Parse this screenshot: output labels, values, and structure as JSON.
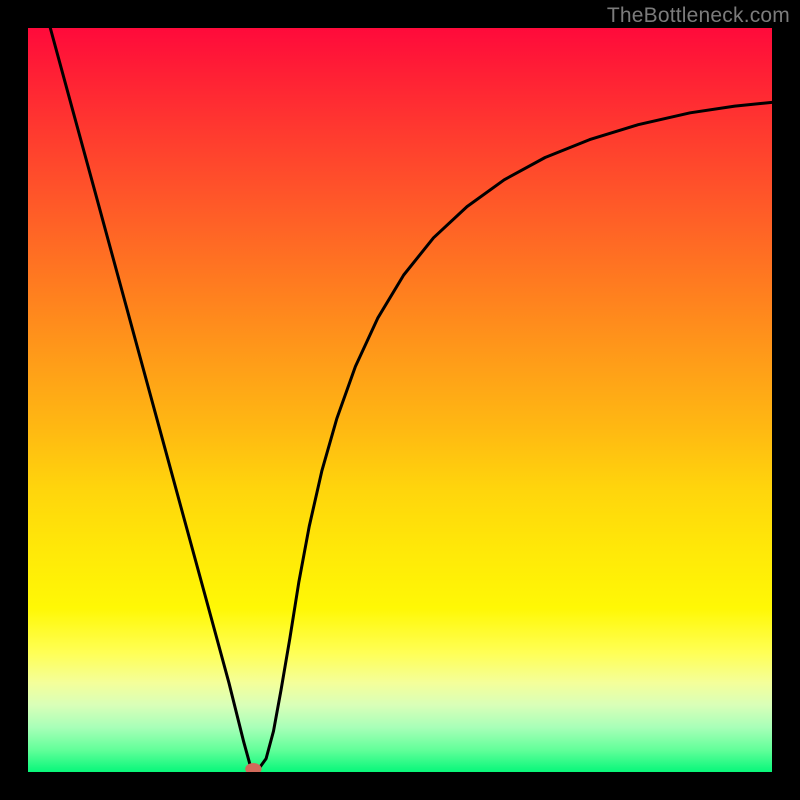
{
  "watermark": "TheBottleneck.com",
  "chart_data": {
    "type": "line",
    "title": "",
    "xlabel": "",
    "ylabel": "",
    "xlim": [
      0,
      1
    ],
    "ylim": [
      0,
      1
    ],
    "legend": false,
    "grid": false,
    "background_gradient": {
      "direction": "vertical",
      "stops": [
        {
          "pos": 0.0,
          "color": "#ff0a3b"
        },
        {
          "pos": 0.3,
          "color": "#ff7a20"
        },
        {
          "pos": 0.6,
          "color": "#ffd50c"
        },
        {
          "pos": 0.85,
          "color": "#ffff56"
        },
        {
          "pos": 1.0,
          "color": "#08f77a"
        }
      ]
    },
    "series": [
      {
        "name": "curve",
        "x": [
          0.03,
          0.06,
          0.09,
          0.12,
          0.15,
          0.18,
          0.21,
          0.24,
          0.27,
          0.29,
          0.3,
          0.31,
          0.32,
          0.33,
          0.34,
          0.352,
          0.364,
          0.378,
          0.395,
          0.415,
          0.44,
          0.47,
          0.505,
          0.545,
          0.59,
          0.64,
          0.695,
          0.755,
          0.82,
          0.89,
          0.95,
          1.0
        ],
        "y": [
          1.0,
          0.89,
          0.78,
          0.67,
          0.56,
          0.45,
          0.34,
          0.23,
          0.12,
          0.04,
          0.004,
          0.004,
          0.018,
          0.055,
          0.11,
          0.18,
          0.255,
          0.33,
          0.405,
          0.475,
          0.545,
          0.61,
          0.668,
          0.718,
          0.76,
          0.796,
          0.826,
          0.85,
          0.87,
          0.886,
          0.895,
          0.9
        ]
      }
    ],
    "marker": {
      "x": 0.303,
      "y": 0.004,
      "color": "#d06a5a",
      "rx": 0.011,
      "ry": 0.008
    }
  }
}
